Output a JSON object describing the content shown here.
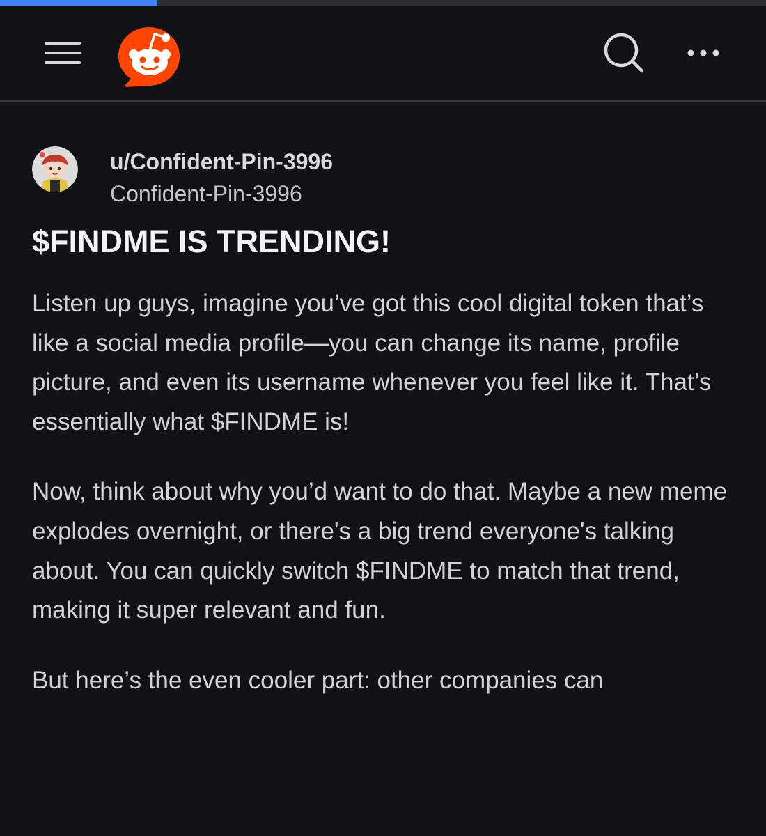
{
  "load_progress": 0.205,
  "colors": {
    "background": "#101216",
    "brand": "#ff4500",
    "progress": "#3b82f6",
    "text": "#d0d3d7"
  },
  "header": {
    "menu_icon": "hamburger-menu-icon",
    "logo_icon": "reddit-logo",
    "search_icon": "search-icon",
    "more_icon": "more-options-icon"
  },
  "post": {
    "author": {
      "username": "u/Confident-Pin-3996",
      "display_name": "Confident-Pin-3996",
      "avatar_icon": "snoo-avatar"
    },
    "title": "$FINDME IS TRENDING!",
    "paragraphs": [
      "Listen up guys, imagine you’ve got this cool digital token that’s like a social media profile—you can change its name, profile picture, and even its username whenever you feel like it. That’s essentially what $FINDME is!",
      "Now, think about why you’d want to do that. Maybe a new meme explodes overnight, or there's a big trend everyone's talking about. You can quickly switch $FINDME to match that trend, making it super relevant and fun.",
      "But here’s the even cooler part: other companies can"
    ]
  }
}
